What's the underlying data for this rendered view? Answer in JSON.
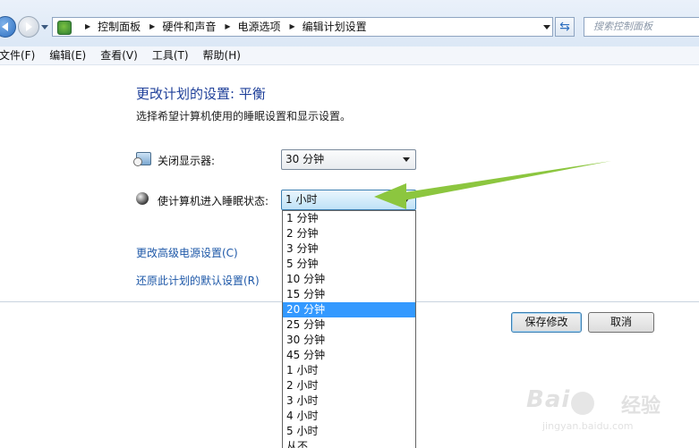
{
  "address_bar": {
    "breadcrumbs": [
      "控制面板",
      "硬件和声音",
      "电源选项",
      "编辑计划设置"
    ],
    "search_placeholder": "搜索控制面板"
  },
  "menu": {
    "items": [
      "文件(F)",
      "编辑(E)",
      "查看(V)",
      "工具(T)",
      "帮助(H)"
    ]
  },
  "main": {
    "title": "更改计划的设置: 平衡",
    "subtitle": "选择希望计算机使用的睡眠设置和显示设置。",
    "display_off": {
      "label": "关闭显示器:",
      "value": "30 分钟"
    },
    "sleep": {
      "label": "使计算机进入睡眠状态:",
      "value": "1 小时"
    },
    "links": {
      "advanced": "更改高级电源设置(C)",
      "restore": "还原此计划的默认设置(R)"
    },
    "buttons": {
      "save": "保存修改",
      "cancel": "取消"
    }
  },
  "dropdown": {
    "options": [
      "1 分钟",
      "2 分钟",
      "3 分钟",
      "5 分钟",
      "10 分钟",
      "15 分钟",
      "20 分钟",
      "25 分钟",
      "30 分钟",
      "45 分钟",
      "1 小时",
      "2 小时",
      "3 小时",
      "4 小时",
      "5 小时",
      "从不"
    ],
    "highlighted": "20 分钟"
  },
  "watermark": {
    "brand": "Bai",
    "product": "经验",
    "url": "jingyan.baidu.com"
  },
  "colors": {
    "link": "#1e58a8",
    "title": "#1e3f99",
    "highlight": "#3399ff",
    "annotation_arrow": "#8cc63f"
  }
}
